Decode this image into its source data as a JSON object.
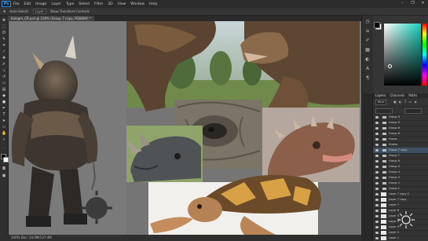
{
  "menubar": {
    "logo": "Ps",
    "items": [
      "File",
      "Edit",
      "Image",
      "Layer",
      "Type",
      "Select",
      "Filter",
      "3D",
      "View",
      "Window",
      "Help"
    ],
    "window_controls": [
      "–",
      "❐",
      "✕"
    ]
  },
  "options": {
    "items": [
      "Auto-Select:",
      "Layer",
      "Show Transform Controls"
    ]
  },
  "document": {
    "tab_title": "Kaiogre_CR.psd @ 100% (Group 7 copy, RGB/8#) *",
    "status_text": "100%   Doc: 24.0M/137.4M"
  },
  "tools": [
    "move-tool-icon",
    "marquee-tool-icon",
    "lasso-tool-icon",
    "quick-select-tool-icon",
    "crop-tool-icon",
    "eyedropper-tool-icon",
    "healing-tool-icon",
    "brush-tool-icon",
    "clone-stamp-tool-icon",
    "history-brush-tool-icon",
    "eraser-tool-icon",
    "gradient-tool-icon",
    "blur-tool-icon",
    "dodge-tool-icon",
    "pen-tool-icon",
    "type-tool-icon",
    "path-select-tool-icon",
    "shape-tool-icon",
    "hand-tool-icon",
    "zoom-tool-icon"
  ],
  "colors": {
    "canvas_bg": "#757575",
    "accent": "#31a8ff",
    "selected_hue": "#16d2bf"
  },
  "layers": {
    "tabs": [
      "Layers",
      "Channels",
      "Paths"
    ],
    "kind_label": "Kind",
    "items": [
      {
        "type": "group",
        "name": "Group 9"
      },
      {
        "type": "group",
        "name": "Group 9"
      },
      {
        "type": "group",
        "name": "Group 8"
      },
      {
        "type": "group",
        "name": "Group 8"
      },
      {
        "type": "group",
        "name": "Group"
      },
      {
        "type": "group",
        "name": "Scales"
      },
      {
        "type": "group",
        "name": "Group 7 copy"
      },
      {
        "type": "group",
        "name": "Group 7"
      },
      {
        "type": "group",
        "name": "Group 6"
      },
      {
        "type": "group",
        "name": "Group 5"
      },
      {
        "type": "group",
        "name": "Group 4"
      },
      {
        "type": "group",
        "name": "Group 3"
      },
      {
        "type": "group",
        "name": "Group 2"
      },
      {
        "type": "group",
        "name": "Group 1"
      },
      {
        "type": "layer",
        "name": "Layer 7 copy 2"
      },
      {
        "type": "layer",
        "name": "Layer 7 copy"
      },
      {
        "type": "layer",
        "name": "Layer 7"
      },
      {
        "type": "layer",
        "name": "Layer 6"
      },
      {
        "type": "layer",
        "name": "Layer 5"
      },
      {
        "type": "layer",
        "name": "Layer 4"
      },
      {
        "type": "layer",
        "name": "Layer 3"
      },
      {
        "type": "layer",
        "name": "Layer 2"
      },
      {
        "type": "layer",
        "name": "Layer 1"
      }
    ]
  }
}
